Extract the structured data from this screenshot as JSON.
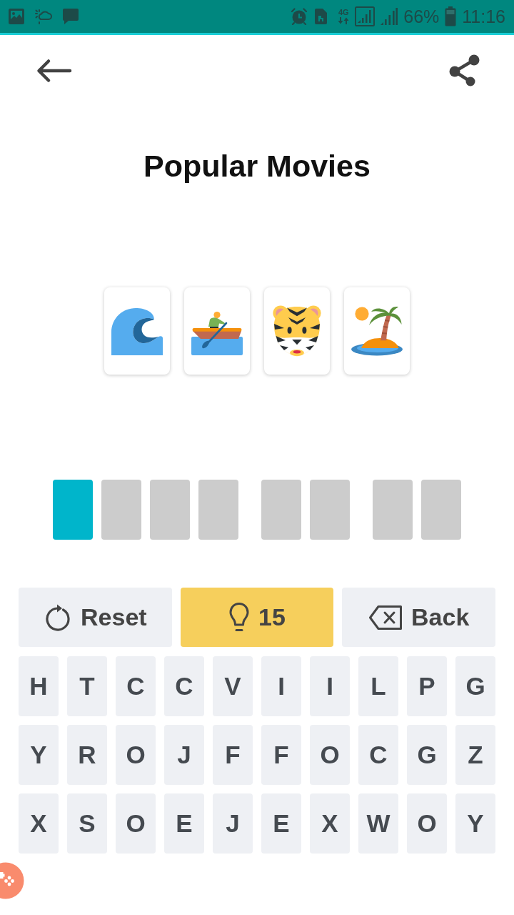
{
  "status_bar": {
    "network": "4G",
    "battery": "66%",
    "time": "11:16"
  },
  "header": {
    "title": "Popular Movies"
  },
  "clues": [
    {
      "kind": "wave"
    },
    {
      "kind": "rowboat"
    },
    {
      "kind": "tiger"
    },
    {
      "kind": "island"
    }
  ],
  "answer": [
    {
      "slots": [
        {
          "selected": true
        },
        {
          "selected": false
        },
        {
          "selected": false
        },
        {
          "selected": false
        }
      ]
    },
    {
      "slots": [
        {
          "selected": false
        },
        {
          "selected": false
        }
      ]
    },
    {
      "slots": [
        {
          "selected": false
        },
        {
          "selected": false
        }
      ]
    }
  ],
  "actions": [
    {
      "kind": "reset",
      "label": "Reset"
    },
    {
      "kind": "hint",
      "label": "15"
    },
    {
      "kind": "back",
      "label": "Back"
    }
  ],
  "keyboard": [
    [
      "H",
      "T",
      "C",
      "C",
      "V",
      "I",
      "I",
      "L",
      "P",
      "G"
    ],
    [
      "Y",
      "R",
      "O",
      "J",
      "F",
      "F",
      "O",
      "C",
      "G",
      "Z"
    ],
    [
      "X",
      "S",
      "O",
      "E",
      "J",
      "E",
      "X",
      "W",
      "O",
      "Y"
    ]
  ]
}
